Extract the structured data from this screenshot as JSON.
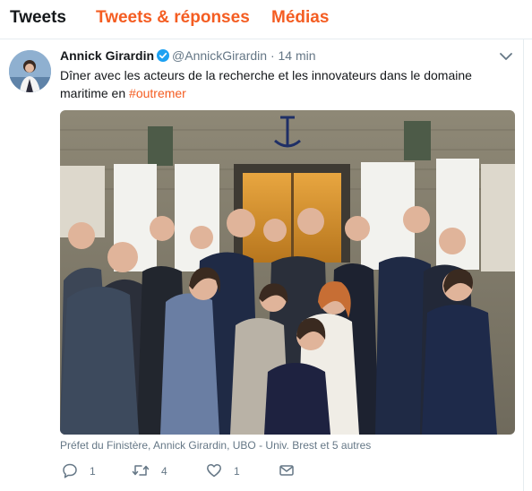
{
  "tabs": {
    "tweets": "Tweets",
    "tweets_replies": "Tweets & réponses",
    "media": "Médias"
  },
  "tweet": {
    "author_name": "Annick Girardin",
    "handle": "@AnnickGirardin",
    "separator": "·",
    "time": "14 min",
    "text_main": "Dîner avec les acteurs de la recherche et les innovateurs dans le domaine maritime en ",
    "hashtag": "#outremer",
    "photo_tags": "Préfet du Finistère, Annick Girardin, UBO - Univ. Brest et 5 autres",
    "counts": {
      "replies": "1",
      "retweets": "4",
      "likes": "1"
    }
  },
  "colors": {
    "accent": "#f45d22",
    "verified": "#1da1f2",
    "text": "#14171a",
    "secondary": "#657786"
  },
  "icons": [
    "verified-badge-icon",
    "chevron-down-icon",
    "reply-icon",
    "retweet-icon",
    "like-icon",
    "message-icon"
  ]
}
